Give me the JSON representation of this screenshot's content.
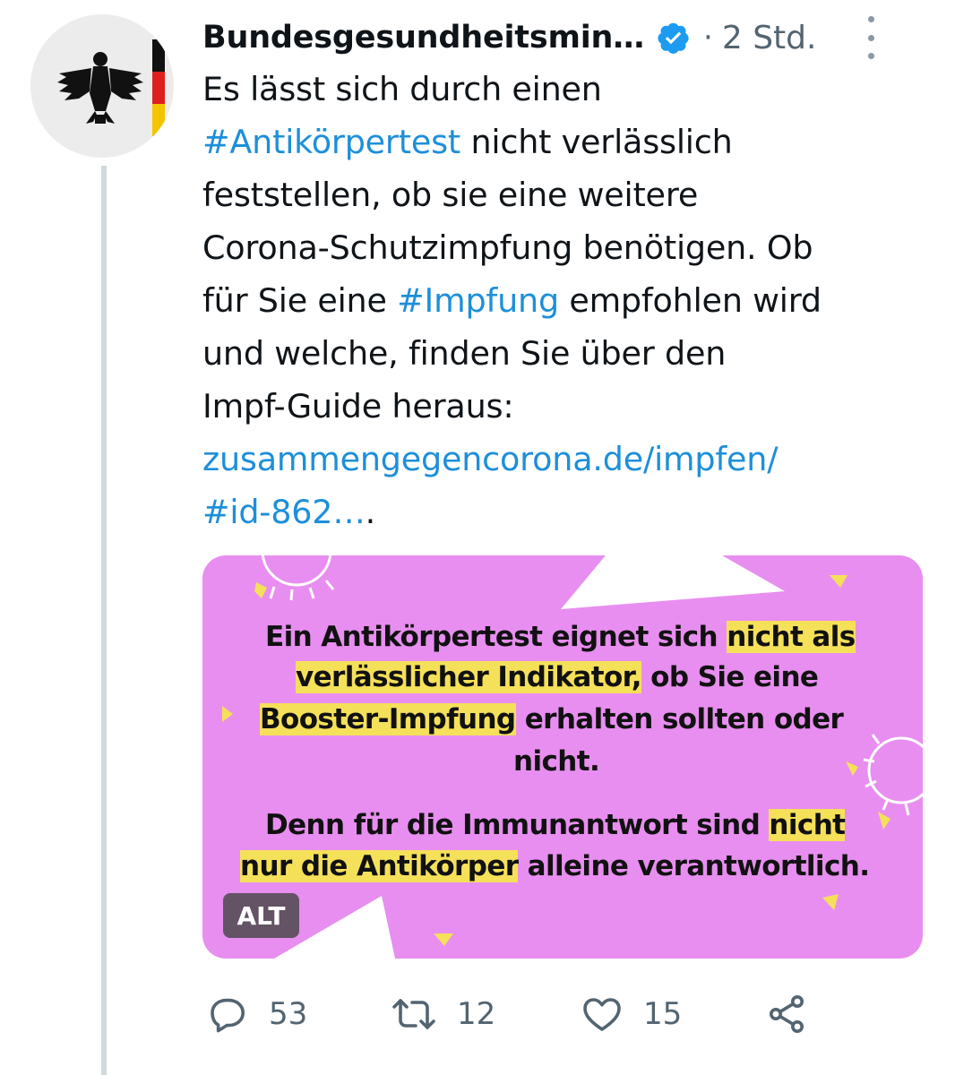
{
  "tweet": {
    "author_name": "Bundesgesundheitsmin…",
    "separator": "·",
    "time": "2 Std.",
    "text": {
      "l1": "Es lässt sich durch einen",
      "l2_link": "#Antikörpertest",
      "l2_rest": " nicht verlässlich",
      "l3": "feststellen, ob sie eine weitere",
      "l4": "Corona-Schutzimpfung benötigen. Ob",
      "l5_a": "für Sie eine ",
      "l5_link": "#Impfung",
      "l5_b": " empfohlen wird",
      "l6": "und welche, finden Sie über den",
      "l7": "Impf-Guide heraus:",
      "l8_link": "zusammengegencorona.de/impfen/",
      "l9_link": "#id-862…",
      "l9_rest": "."
    },
    "media": {
      "p1_l1_a": "Ein Antikörpertest eignet sich ",
      "p1_l1_hl": "nicht als",
      "p1_l2_hl": "verlässlicher Indikator,",
      "p1_l2_b": " ob Sie eine",
      "p1_l3_hl": "Booster-Impfung",
      "p1_l3_b": " erhalten sollten oder",
      "p1_l4": "nicht.",
      "p2_l1_a": "Denn für die Immunantwort sind ",
      "p2_l1_hl": "nicht",
      "p2_l2_hl": "nur die Antikörper",
      "p2_l2_b": " alleine verantwortlich.",
      "alt_label": "ALT",
      "bg_color": "#e88ef0",
      "highlight_color": "#f5e05a"
    },
    "actions": {
      "reply_icon": "reply-icon",
      "reply_count": "53",
      "retweet_icon": "retweet-icon",
      "retweet_count": "12",
      "like_icon": "heart-icon",
      "like_count": "15",
      "share_icon": "share-icon"
    },
    "colors": {
      "link": "#1d8fd9",
      "secondary_text": "#536471",
      "verified_badge": "#1d9bf0"
    }
  }
}
